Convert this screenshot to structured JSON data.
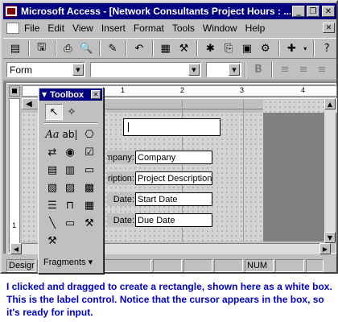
{
  "window": {
    "title": "Microsoft Access - [Network Consultants Project Hours : ...",
    "minimize": "_",
    "restore": "❐",
    "close": "✕"
  },
  "menubar": {
    "items": [
      "File",
      "Edit",
      "View",
      "Insert",
      "Format",
      "Tools",
      "Window",
      "Help"
    ],
    "close": "✕"
  },
  "toolbar2": {
    "object_combo": "Form",
    "bold": "B"
  },
  "ruler": {
    "h_marks": [
      "1",
      "2",
      "3",
      "4"
    ],
    "v_marks": [
      "1"
    ]
  },
  "form": {
    "fields": [
      {
        "label": "ompany:",
        "value": "Company"
      },
      {
        "label": "ription:",
        "value": "Project Description"
      },
      {
        "label": "Date:",
        "value": "Start Date"
      },
      {
        "label": "Date:",
        "value": "Due Date"
      }
    ]
  },
  "toolbox": {
    "title": "Toolbox",
    "fragments_label": "Fragments ▾",
    "tools": [
      "select-objects",
      "control-wizards",
      "label",
      "text-box",
      "option-group",
      "toggle-button",
      "option-button",
      "check-box",
      "combo-box",
      "list-box",
      "command-button",
      "image",
      "unbound-object-frame",
      "bound-object-frame",
      "page-break",
      "tab-control",
      "subform",
      "line",
      "rectangle",
      "more-controls",
      "wizard"
    ]
  },
  "statusbar": {
    "mode": "Design",
    "num": "NUM"
  },
  "caption": {
    "text": "I clicked and dragged to create a rectangle, shown here as a  white box. This is the label control. Notice that the cursor appears in the box, so it's ready for input."
  }
}
